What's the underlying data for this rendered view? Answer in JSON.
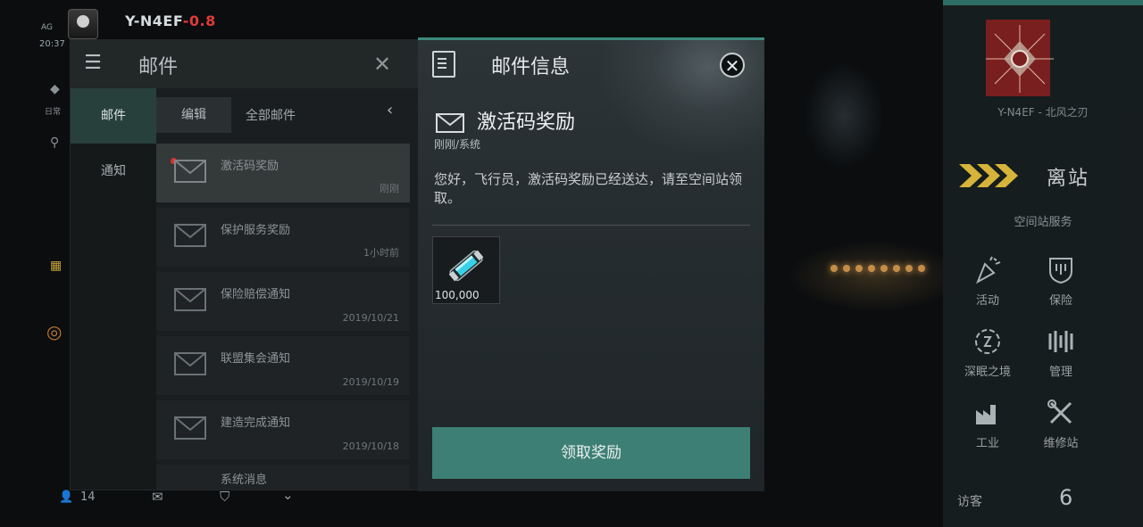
{
  "hud": {
    "pilot_name": "Y-N4EF",
    "security": "-0.8",
    "clock": "20:37",
    "clock_label": "AG",
    "side_icon_label": "日常"
  },
  "mail_panel": {
    "title": "邮件",
    "tabs": [
      {
        "label": "邮件",
        "active": true
      },
      {
        "label": "通知",
        "active": false
      }
    ],
    "edit_label": "编辑",
    "filter_label": "全部邮件",
    "items": [
      {
        "title": "激活码奖励",
        "date": "刚刚",
        "unread": true,
        "selected": true
      },
      {
        "title": "保护服务奖励",
        "date": "1小时前",
        "unread": false,
        "selected": false
      },
      {
        "title": "保险赔偿通知",
        "date": "2019/10/21",
        "unread": false,
        "selected": false
      },
      {
        "title": "联盟集会通知",
        "date": "2019/10/19",
        "unread": false,
        "selected": false
      },
      {
        "title": "建造完成通知",
        "date": "2019/10/18",
        "unread": false,
        "selected": false
      },
      {
        "title": "系统消息",
        "date": "",
        "unread": false,
        "selected": false
      }
    ]
  },
  "bottom_hud": {
    "player_count": "14"
  },
  "detail": {
    "title": "邮件信息",
    "subject": "激活码奖励",
    "meta": "刚刚/系统",
    "body": "您好，飞行员，激活码奖励已经送达，请至空间站领取。",
    "reward": {
      "icon": "energy-canister-icon",
      "quantity": "100,000"
    },
    "claim_label": "领取奖励"
  },
  "right_panel": {
    "corp_name": "Y-N4EF - 北风之刃",
    "undock_label": "离站",
    "station_services_label": "空间站服务",
    "services": [
      {
        "label": "活动",
        "icon": "party-popper-icon"
      },
      {
        "label": "保险",
        "icon": "shield-icon"
      },
      {
        "label": "深眠之境",
        "icon": "deep-sleep-icon"
      },
      {
        "label": "管理",
        "icon": "management-icon"
      },
      {
        "label": "工业",
        "icon": "factory-icon"
      },
      {
        "label": "维修站",
        "icon": "repair-tools-icon"
      }
    ],
    "visitors_label": "访客",
    "visitors_count": "6"
  },
  "colors": {
    "accent": "#3e7f75",
    "tab_active": "#28403b",
    "danger": "#e03a3a",
    "undock_arrow": "#d6b43a"
  }
}
